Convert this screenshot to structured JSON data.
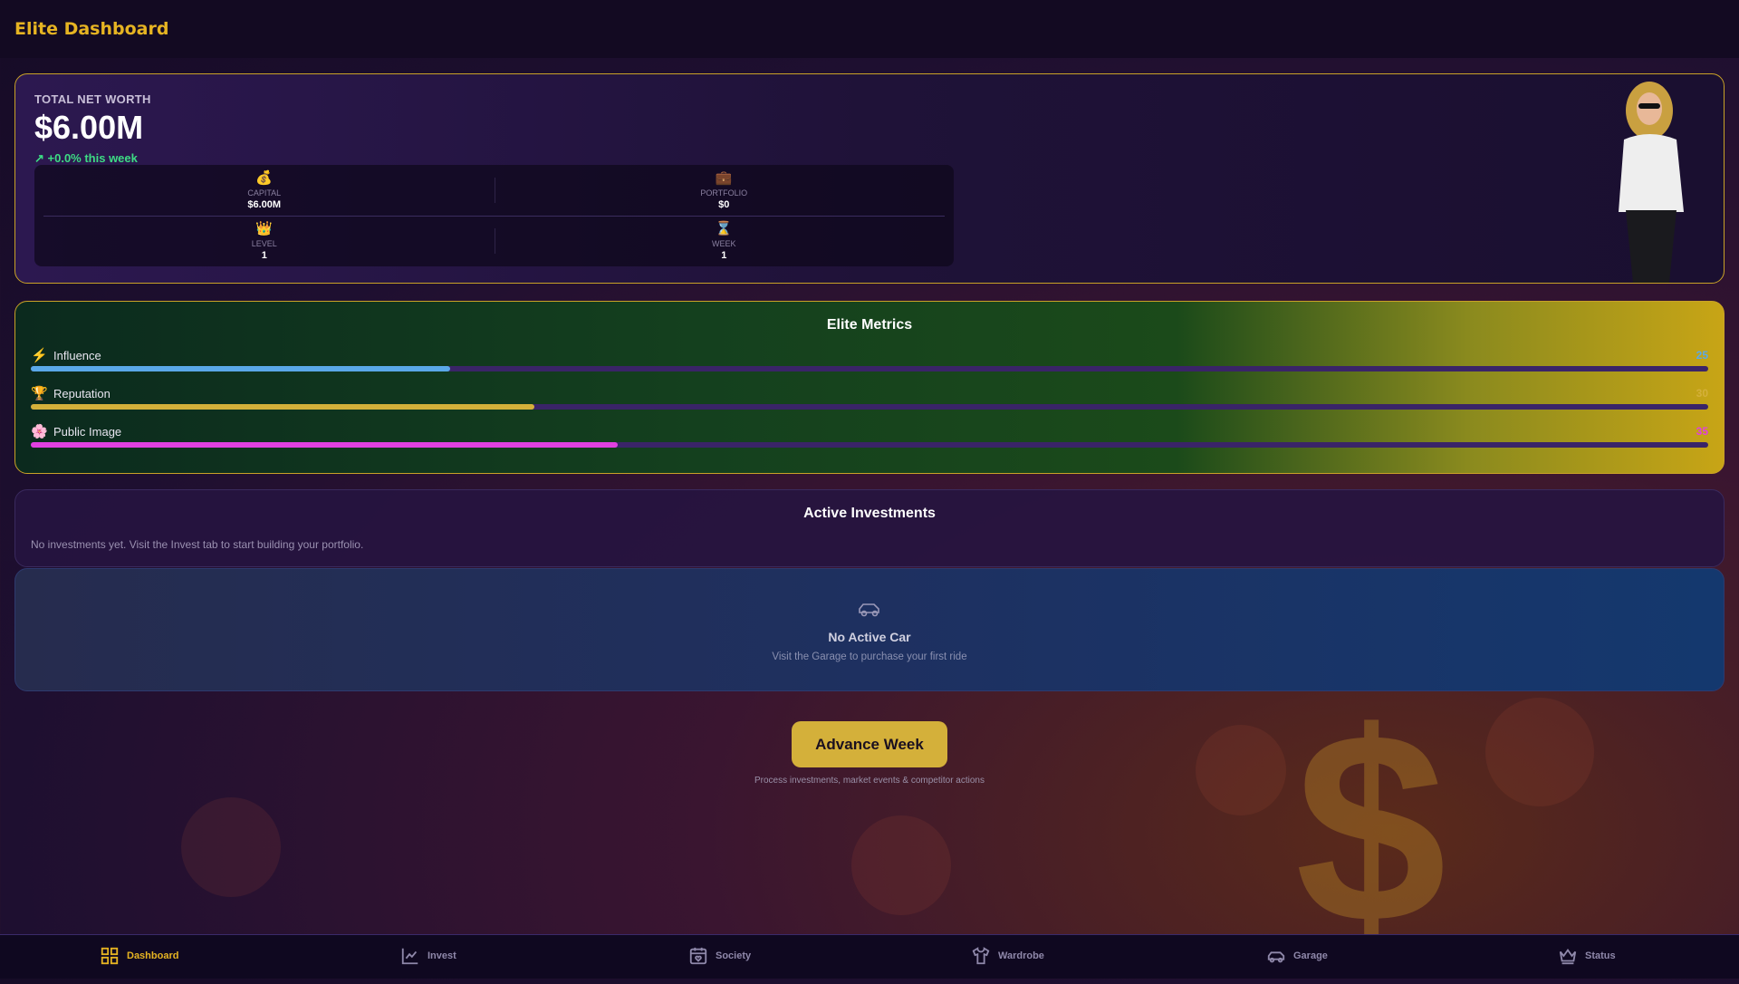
{
  "header": {
    "title": "Elite Dashboard"
  },
  "networth": {
    "label": "TOTAL NET WORTH",
    "value": "$6.00M",
    "change": "+0.0% this week",
    "stats": [
      {
        "icon": "coins-icon",
        "label": "CAPITAL",
        "value": "$6.00M"
      },
      {
        "icon": "briefcase-icon",
        "label": "PORTFOLIO",
        "value": "$0"
      },
      {
        "icon": "crown-icon",
        "label": "LEVEL",
        "value": "1"
      },
      {
        "icon": "hourglass-icon",
        "label": "WEEK",
        "value": "1"
      }
    ]
  },
  "metrics": {
    "title": "Elite Metrics",
    "items": [
      {
        "name": "Influence",
        "value": "25",
        "percent": 25,
        "color": "#5aa8e8"
      },
      {
        "name": "Reputation",
        "value": "30",
        "percent": 30,
        "color": "#d4b03a"
      },
      {
        "name": "Public Image",
        "value": "35",
        "percent": 35,
        "color": "#e040e0"
      }
    ]
  },
  "investments": {
    "title": "Active Investments",
    "empty": "No investments yet. Visit the Invest tab to start building your portfolio."
  },
  "car": {
    "title": "No Active Car",
    "subtitle": "Visit the Garage to purchase your first ride"
  },
  "advance": {
    "label": "Advance Week",
    "note": "Process investments, market events & competitor actions"
  },
  "nav": [
    {
      "label": "Dashboard",
      "active": true
    },
    {
      "label": "Invest"
    },
    {
      "label": "Society"
    },
    {
      "label": "Wardrobe"
    },
    {
      "label": "Garage"
    },
    {
      "label": "Status"
    }
  ],
  "colors": {
    "accent": "#e6b422",
    "positive": "#3ddc84"
  }
}
